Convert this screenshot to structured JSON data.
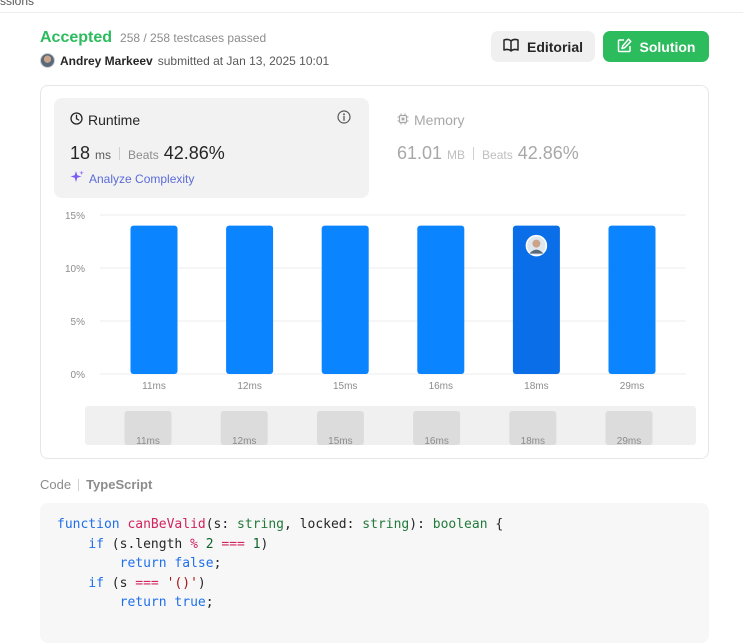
{
  "header": {
    "top_fragment": "ssions",
    "status": "Accepted",
    "testcases": "258 / 258 testcases passed",
    "author": "Andrey Markeev",
    "submitted": "submitted at Jan 13, 2025 10:01",
    "editorial_label": "Editorial",
    "solution_label": "Solution"
  },
  "runtime": {
    "title": "Runtime",
    "value": "18",
    "unit": "ms",
    "beats_label": "Beats",
    "beats_value": "42.86%",
    "analyze_label": "Analyze Complexity"
  },
  "memory": {
    "title": "Memory",
    "value": "61.01",
    "unit": "MB",
    "beats_label": "Beats",
    "beats_value": "42.86%"
  },
  "chart_data": {
    "type": "bar",
    "categories": [
      "11ms",
      "12ms",
      "15ms",
      "16ms",
      "18ms",
      "29ms"
    ],
    "values": [
      14,
      14,
      14,
      14,
      14,
      14
    ],
    "highlight": "18ms",
    "ylim": [
      0,
      15
    ],
    "yticks": [
      "0%",
      "5%",
      "10%",
      "15%"
    ],
    "ytick_values": [
      0,
      5,
      10,
      15
    ],
    "grid": true,
    "bar_color": "#0a84ff",
    "highlight_color": "#0a6ee8",
    "minimap_labels": [
      "11ms",
      "12ms",
      "15ms",
      "16ms",
      "18ms",
      "29ms"
    ]
  },
  "code": {
    "label": "Code",
    "language": "TypeScript"
  },
  "colors": {
    "accepted": "#2cbb5d",
    "solution_button": "#2cbb5d",
    "analyze_link": "#5a6bd8"
  }
}
